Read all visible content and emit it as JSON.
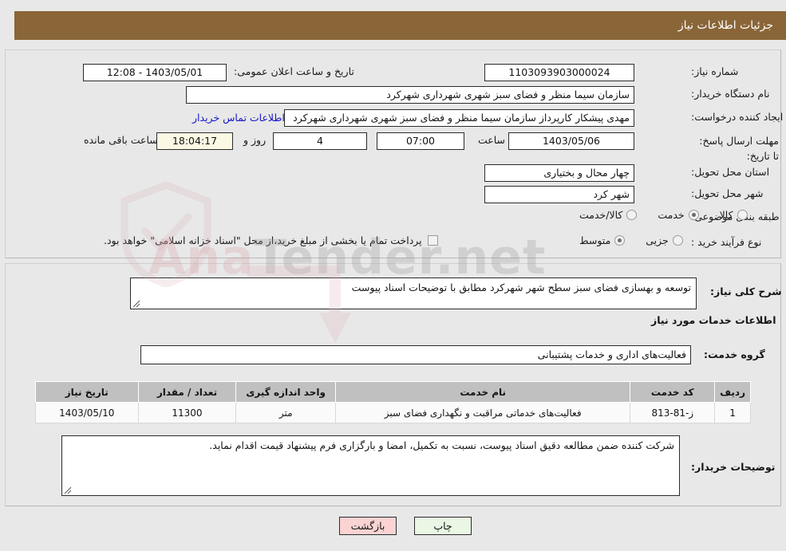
{
  "header": {
    "title": "جزئیات اطلاعات نیاز"
  },
  "top_form": {
    "need_number_label": "شماره نیاز:",
    "need_number_value": "1103093903000024",
    "announce_datetime_label": "تاریخ و ساعت اعلان عمومی:",
    "announce_datetime_value": "1403/05/01 - 12:08",
    "buyer_org_label": "نام دستگاه خریدار:",
    "buyer_org_value": "سازمان سیما منظر و فضای سبز شهری شهرداری شهرکرد",
    "requester_label": "ایجاد کننده درخواست:",
    "requester_value": "مهدی پیشکار کارپرداز سازمان سیما منظر و فضای سبز شهری شهرداری شهرکرد",
    "contact_link": "اطلاعات تماس خریدار",
    "deadline_label": "مهلت ارسال پاسخ: تا تاریخ:",
    "deadline_date": "1403/05/06",
    "deadline_hour_label": "ساعت",
    "deadline_hour": "07:00",
    "days_remaining": "4",
    "days_word": "روز و",
    "time_remaining": "18:04:17",
    "remaining_suffix": "ساعت باقی مانده",
    "province_label": "استان محل تحویل:",
    "province_value": "چهار محال و بختیاری",
    "city_label": "شهر محل تحویل:",
    "city_value": "شهر کرد",
    "category_label": "طبقه بندی موضوعی:",
    "category_options": [
      {
        "label": "کالا",
        "selected": false
      },
      {
        "label": "خدمت",
        "selected": true
      },
      {
        "label": "کالا/خدمت",
        "selected": false
      }
    ],
    "process_label": "نوع فرآیند خرید :",
    "process_options": [
      {
        "label": "جزیی",
        "selected": false
      },
      {
        "label": "متوسط",
        "selected": true
      }
    ],
    "treasury_checkbox_text": "پرداخت تمام یا بخشی از مبلغ خرید،از محل \"اسناد خزانه اسلامی\" خواهد بود.",
    "treasury_checked": false
  },
  "middle": {
    "general_desc_label": "شرح کلی نیاز:",
    "general_desc_value": "توسعه و بهسازی فضای سبز سطح شهر شهرکرد مطابق با توضیحات اسناد پیوست",
    "services_section_title": "اطلاعات خدمات مورد نیاز",
    "service_group_label": "گروه خدمت:",
    "service_group_value": "فعالیت‌های اداری و خدمات پشتیبانی",
    "buyer_notes_label": "توضیحات خریدار:",
    "buyer_notes_value": "شرکت کننده ضمن مطالعه دقیق اسناد پیوست، نسبت به تکمیل، امضا و بارگزاری فرم پیشنهاد قیمت اقدام نماید."
  },
  "table": {
    "columns": [
      "ردیف",
      "کد خدمت",
      "نام خدمت",
      "واحد اندازه گیری",
      "تعداد / مقدار",
      "تاریخ نیاز"
    ],
    "rows": [
      {
        "radif": "1",
        "code": "ز-81-813",
        "name": "فعالیت‌های خدماتی مراقبت و نگهداری فضای سبز",
        "unit": "متر",
        "quantity": "11300",
        "need_date": "1403/05/10"
      }
    ]
  },
  "footer": {
    "print_label": "چاپ",
    "back_label": "بازگشت"
  },
  "watermark": {
    "brand_prefix": "Ana",
    "brand_suffix": "Tender.net"
  },
  "colors": {
    "header_bar": "#8a6538",
    "page_bg": "#e8e8e8",
    "link": "#1414c8",
    "print_btn": "#e9f7e4",
    "back_btn": "#fbd3d3",
    "table_header": "#c0c0c0",
    "countdown_field": "#fbf8e3"
  }
}
